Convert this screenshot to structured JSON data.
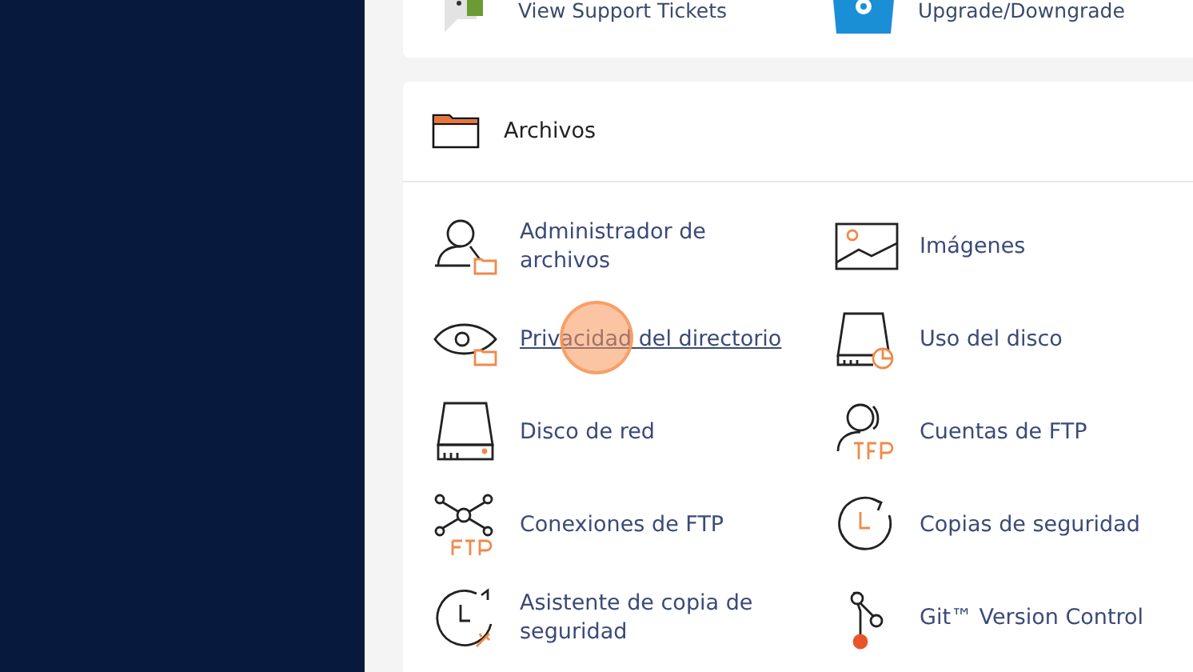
{
  "top_card": {
    "items": [
      "View Support Tickets",
      "Upgrade/Downgrade"
    ]
  },
  "section": {
    "title": "Archivos",
    "items": [
      {
        "label": "Administrador de archivos",
        "hovered": false
      },
      {
        "label": "Imágenes",
        "hovered": false
      },
      {
        "label": "Privacidad del directorio",
        "hovered": true
      },
      {
        "label": "Uso del disco",
        "hovered": false
      },
      {
        "label": "Disco de red",
        "hovered": false
      },
      {
        "label": "Cuentas de FTP",
        "hovered": false
      },
      {
        "label": "Conexiones de FTP",
        "hovered": false
      },
      {
        "label": "Copias de seguridad",
        "hovered": false
      },
      {
        "label": "Asistente de copia de seguridad",
        "hovered": false
      },
      {
        "label": "Git™ Version Control",
        "hovered": false
      }
    ]
  }
}
